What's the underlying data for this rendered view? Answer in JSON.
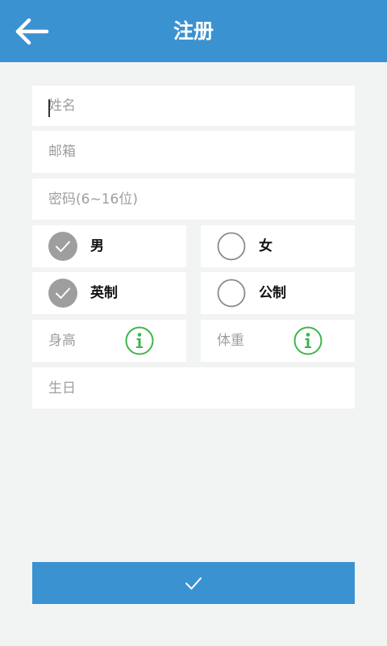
{
  "header": {
    "title": "注册",
    "back_icon": "arrow-left-icon"
  },
  "form": {
    "name_placeholder": "姓名",
    "email_placeholder": "邮箱",
    "password_placeholder": "密码(6~16位)",
    "gender": {
      "male_label": "男",
      "female_label": "女",
      "selected": "男"
    },
    "unit": {
      "imperial_label": "英制",
      "metric_label": "公制",
      "selected": "英制"
    },
    "height_label": "身高",
    "weight_label": "体重",
    "birthday_placeholder": "生日"
  },
  "submit": {
    "icon": "check-icon"
  },
  "colors": {
    "primary": "#3b92d0",
    "background": "#f2f4f3",
    "checked": "#9e9e9e",
    "info": "#3cb54a"
  }
}
